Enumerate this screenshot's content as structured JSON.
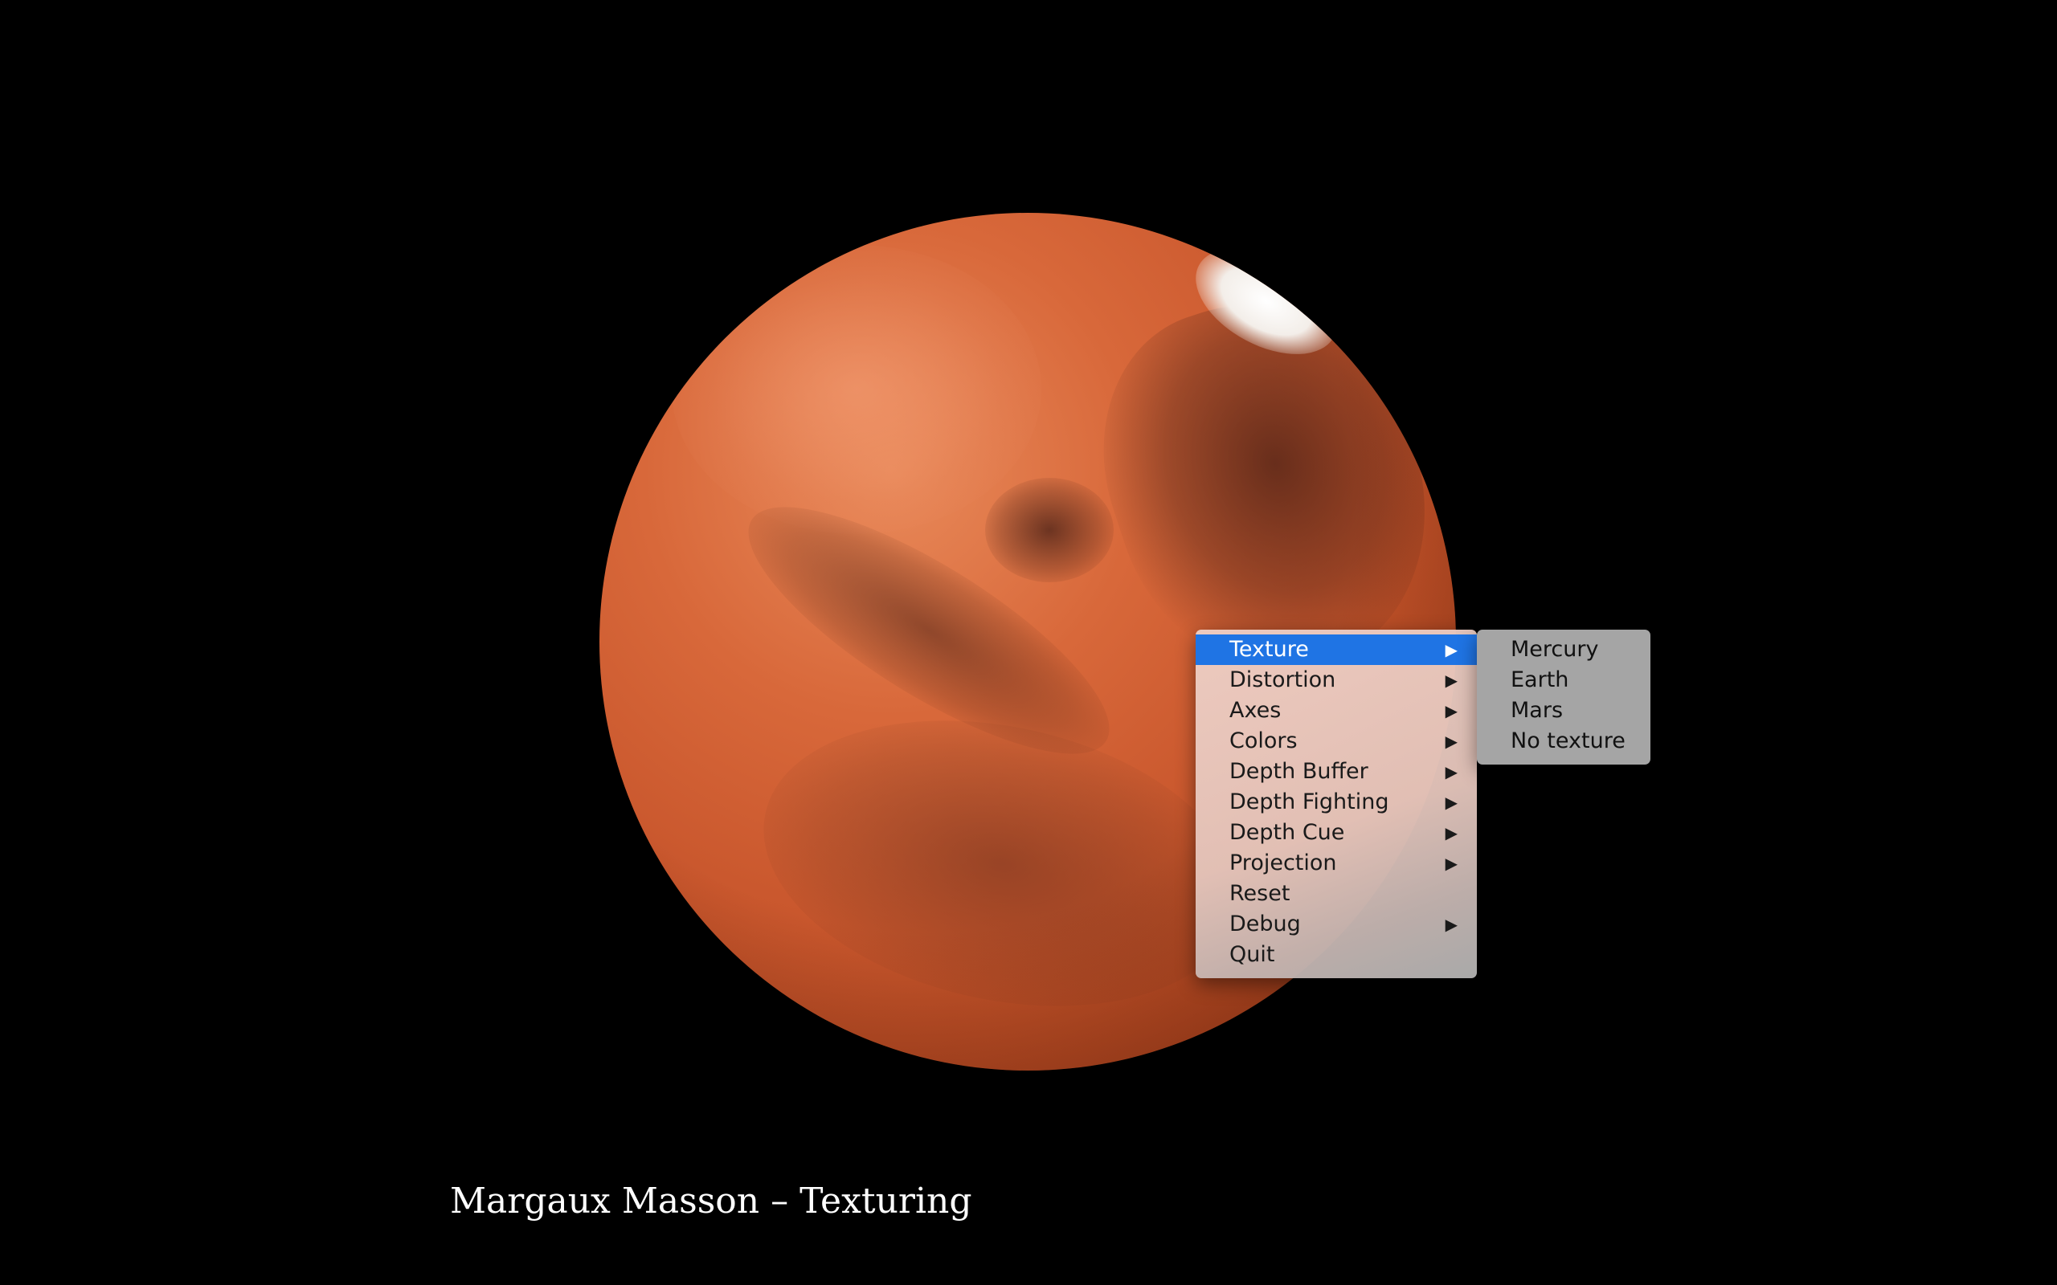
{
  "window": {
    "caption": "Margaux Masson – Texturing"
  },
  "scene": {
    "object": "mars-globe",
    "background_color": "#000000"
  },
  "context_menu": {
    "items": [
      {
        "label": "Texture",
        "has_submenu": true,
        "highlighted": true
      },
      {
        "label": "Distortion",
        "has_submenu": true
      },
      {
        "label": "Axes",
        "has_submenu": true
      },
      {
        "label": "Colors",
        "has_submenu": true
      },
      {
        "label": "Depth Buffer",
        "has_submenu": true
      },
      {
        "label": "Depth Fighting",
        "has_submenu": true
      },
      {
        "label": "Depth Cue",
        "has_submenu": true
      },
      {
        "label": "Projection",
        "has_submenu": true
      },
      {
        "label": "Reset",
        "has_submenu": false
      },
      {
        "label": "Debug",
        "has_submenu": true
      },
      {
        "label": "Quit",
        "has_submenu": false
      }
    ],
    "arrow_glyph": "▶",
    "highlight_color": "#1f74e4"
  },
  "texture_submenu": {
    "items": [
      {
        "label": "Mercury"
      },
      {
        "label": "Earth"
      },
      {
        "label": "Mars"
      },
      {
        "label": "No texture"
      }
    ]
  }
}
